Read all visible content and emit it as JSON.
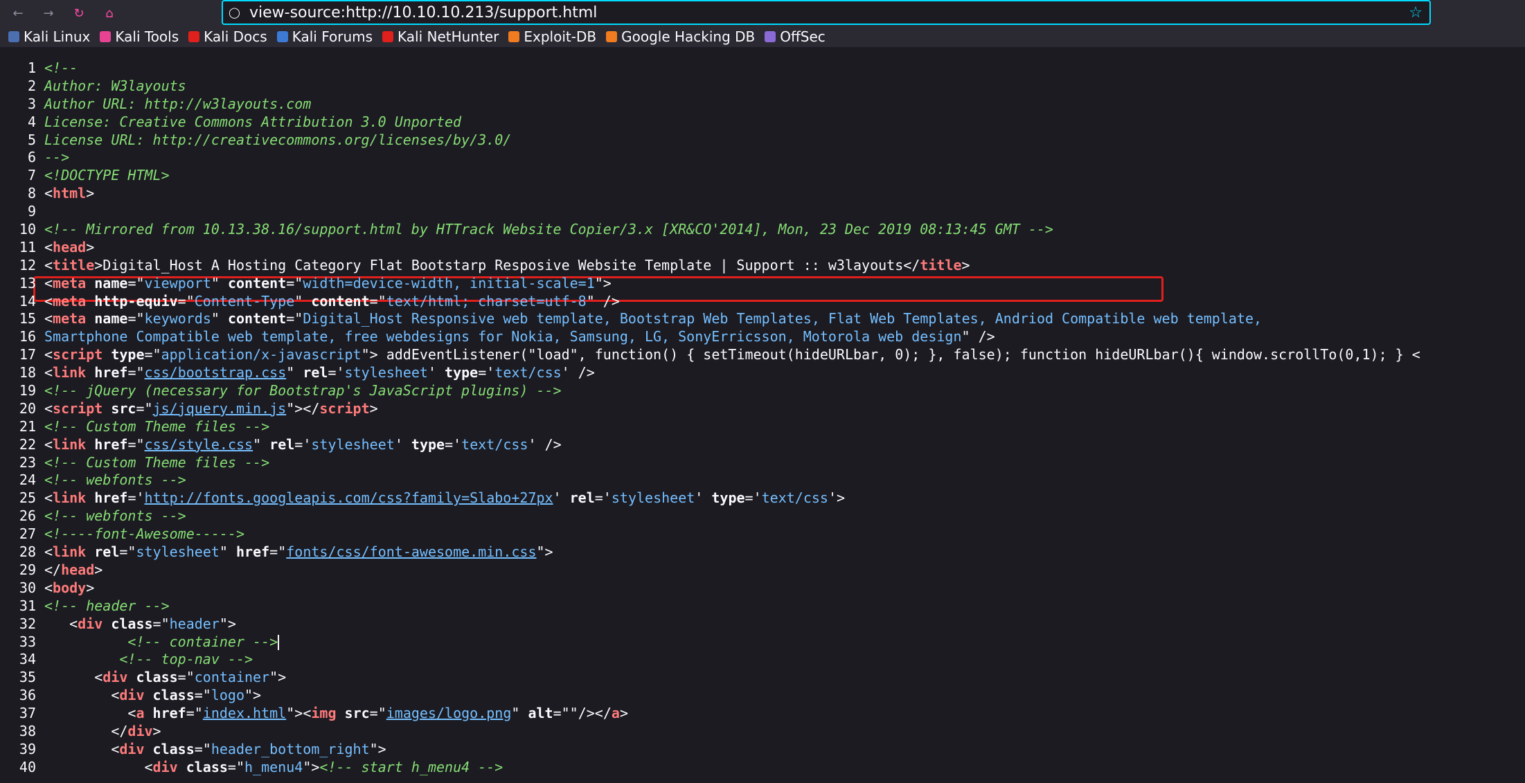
{
  "browser": {
    "url": "view-source:http://10.10.10.213/support.html",
    "bookmarks": [
      {
        "label": "Kali Linux",
        "color": "#4b6fb0"
      },
      {
        "label": "Kali Tools",
        "color": "#e84393"
      },
      {
        "label": "Kali Docs",
        "color": "#e0201c"
      },
      {
        "label": "Kali Forums",
        "color": "#3d7ad6"
      },
      {
        "label": "Kali NetHunter",
        "color": "#e0201c"
      },
      {
        "label": "Exploit-DB",
        "color": "#f07b20"
      },
      {
        "label": "Google Hacking DB",
        "color": "#f07b20"
      },
      {
        "label": "OffSec",
        "color": "#8a6bd6"
      }
    ]
  },
  "source_lines": [
    {
      "n": "1",
      "parts": [
        [
          "c",
          "<!--"
        ]
      ]
    },
    {
      "n": "2",
      "parts": [
        [
          "c",
          "Author: W3layouts"
        ]
      ]
    },
    {
      "n": "3",
      "parts": [
        [
          "c",
          "Author URL: http://w3layouts.com"
        ]
      ]
    },
    {
      "n": "4",
      "parts": [
        [
          "c",
          "License: Creative Commons Attribution 3.0 Unported"
        ]
      ]
    },
    {
      "n": "5",
      "parts": [
        [
          "c",
          "License URL: http://creativecommons.org/licenses/by/3.0/"
        ]
      ]
    },
    {
      "n": "6",
      "parts": [
        [
          "c",
          "-->"
        ]
      ]
    },
    {
      "n": "7",
      "parts": [
        [
          "c",
          "<!DOCTYPE HTML>"
        ]
      ]
    },
    {
      "n": "8",
      "parts": [
        [
          "p",
          "<"
        ],
        [
          "t",
          "html"
        ],
        [
          "p",
          ">"
        ]
      ]
    },
    {
      "n": "9",
      "parts": []
    },
    {
      "n": "10",
      "parts": [
        [
          "c",
          "<!-- Mirrored from 10.13.38.16/support.html by HTTrack Website Copier/3.x [XR&CO'2014], Mon, 23 Dec 2019 08:13:45 GMT -->"
        ]
      ]
    },
    {
      "n": "11",
      "parts": [
        [
          "p",
          "<"
        ],
        [
          "t",
          "head"
        ],
        [
          "p",
          ">"
        ]
      ]
    },
    {
      "n": "12",
      "parts": [
        [
          "p",
          "<"
        ],
        [
          "t",
          "title"
        ],
        [
          "p",
          ">Digital_Host A Hosting Category Flat Bootstarp Resposive Website Template | Support :: w3layouts</"
        ],
        [
          "t",
          "title"
        ],
        [
          "p",
          ">"
        ]
      ]
    },
    {
      "n": "13",
      "parts": [
        [
          "p",
          "<"
        ],
        [
          "t",
          "meta"
        ],
        [
          "a",
          " name"
        ],
        [
          "p",
          "=\""
        ],
        [
          "v",
          "viewport"
        ],
        [
          "p",
          "\""
        ],
        [
          "a",
          " content"
        ],
        [
          "p",
          "=\""
        ],
        [
          "v",
          "width=device-width, initial-scale=1"
        ],
        [
          "p",
          "\">"
        ]
      ]
    },
    {
      "n": "14",
      "parts": [
        [
          "p",
          "<"
        ],
        [
          "t",
          "meta"
        ],
        [
          "a",
          " http-equiv"
        ],
        [
          "p",
          "=\""
        ],
        [
          "v",
          "Content-Type"
        ],
        [
          "p",
          "\""
        ],
        [
          "a",
          " content"
        ],
        [
          "p",
          "=\""
        ],
        [
          "v",
          "text/html; charset=utf-8"
        ],
        [
          "p",
          "\" />"
        ]
      ]
    },
    {
      "n": "15",
      "parts": [
        [
          "p",
          "<"
        ],
        [
          "t",
          "meta"
        ],
        [
          "a",
          " name"
        ],
        [
          "p",
          "=\""
        ],
        [
          "v",
          "keywords"
        ],
        [
          "p",
          "\""
        ],
        [
          "a",
          " content"
        ],
        [
          "p",
          "=\""
        ],
        [
          "v",
          "Digital_Host Responsive web template, Bootstrap Web Templates, Flat Web Templates, Andriod Compatible web template,"
        ]
      ]
    },
    {
      "n": "16",
      "parts": [
        [
          "v",
          "Smartphone Compatible web template, free webdesigns for Nokia, Samsung, LG, SonyErricsson, Motorola web design"
        ],
        [
          "p",
          "\" />"
        ]
      ]
    },
    {
      "n": "17",
      "parts": [
        [
          "p",
          "<"
        ],
        [
          "t",
          "script"
        ],
        [
          "a",
          " type"
        ],
        [
          "p",
          "=\""
        ],
        [
          "v",
          "application/x-javascript"
        ],
        [
          "p",
          "\"> addEventListener(\"load\", function() { setTimeout(hideURLbar, 0); }, false); function hideURLbar(){ window.scrollTo(0,1); } <"
        ]
      ]
    },
    {
      "n": "18",
      "parts": [
        [
          "p",
          "<"
        ],
        [
          "t",
          "link"
        ],
        [
          "a",
          " href"
        ],
        [
          "p",
          "=\""
        ],
        [
          "u",
          "css/bootstrap.css"
        ],
        [
          "p",
          "\""
        ],
        [
          "a",
          " rel"
        ],
        [
          "p",
          "='"
        ],
        [
          "v",
          "stylesheet"
        ],
        [
          "p",
          "'"
        ],
        [
          "a",
          " type"
        ],
        [
          "p",
          "='"
        ],
        [
          "v",
          "text/css"
        ],
        [
          "p",
          "' />"
        ]
      ]
    },
    {
      "n": "19",
      "parts": [
        [
          "c",
          "<!-- jQuery (necessary for Bootstrap's JavaScript plugins) -->"
        ]
      ]
    },
    {
      "n": "20",
      "parts": [
        [
          "p",
          "<"
        ],
        [
          "t",
          "script"
        ],
        [
          "a",
          " src"
        ],
        [
          "p",
          "=\""
        ],
        [
          "u",
          "js/jquery.min.js"
        ],
        [
          "p",
          "\"></"
        ],
        [
          "t",
          "script"
        ],
        [
          "p",
          ">"
        ]
      ]
    },
    {
      "n": "21",
      "parts": [
        [
          "c",
          "<!-- Custom Theme files -->"
        ]
      ]
    },
    {
      "n": "22",
      "parts": [
        [
          "p",
          "<"
        ],
        [
          "t",
          "link"
        ],
        [
          "a",
          " href"
        ],
        [
          "p",
          "=\""
        ],
        [
          "u",
          "css/style.css"
        ],
        [
          "p",
          "\""
        ],
        [
          "a",
          " rel"
        ],
        [
          "p",
          "='"
        ],
        [
          "v",
          "stylesheet"
        ],
        [
          "p",
          "'"
        ],
        [
          "a",
          " type"
        ],
        [
          "p",
          "='"
        ],
        [
          "v",
          "text/css"
        ],
        [
          "p",
          "' />"
        ]
      ]
    },
    {
      "n": "23",
      "parts": [
        [
          "c",
          "<!-- Custom Theme files -->"
        ]
      ]
    },
    {
      "n": "24",
      "parts": [
        [
          "c",
          "<!-- webfonts -->"
        ]
      ]
    },
    {
      "n": "25",
      "parts": [
        [
          "p",
          "<"
        ],
        [
          "t",
          "link"
        ],
        [
          "a",
          " href"
        ],
        [
          "p",
          "='"
        ],
        [
          "u",
          "http://fonts.googleapis.com/css?family=Slabo+27px"
        ],
        [
          "p",
          "'"
        ],
        [
          "a",
          " rel"
        ],
        [
          "p",
          "='"
        ],
        [
          "v",
          "stylesheet"
        ],
        [
          "p",
          "'"
        ],
        [
          "a",
          " type"
        ],
        [
          "p",
          "='"
        ],
        [
          "v",
          "text/css"
        ],
        [
          "p",
          "'>"
        ]
      ]
    },
    {
      "n": "26",
      "parts": [
        [
          "c",
          "<!-- webfonts -->"
        ]
      ]
    },
    {
      "n": "27",
      "parts": [
        [
          "c",
          "<!----font-Awesome----->"
        ]
      ]
    },
    {
      "n": "28",
      "parts": [
        [
          "p",
          "<"
        ],
        [
          "t",
          "link"
        ],
        [
          "a",
          " rel"
        ],
        [
          "p",
          "=\""
        ],
        [
          "v",
          "stylesheet"
        ],
        [
          "p",
          "\""
        ],
        [
          "a",
          " href"
        ],
        [
          "p",
          "=\""
        ],
        [
          "u",
          "fonts/css/font-awesome.min.css"
        ],
        [
          "p",
          "\">"
        ]
      ]
    },
    {
      "n": "29",
      "parts": [
        [
          "p",
          "</"
        ],
        [
          "t",
          "head"
        ],
        [
          "p",
          ">"
        ]
      ]
    },
    {
      "n": "30",
      "parts": [
        [
          "p",
          "<"
        ],
        [
          "t",
          "body"
        ],
        [
          "p",
          ">"
        ]
      ]
    },
    {
      "n": "31",
      "parts": [
        [
          "c",
          "<!-- header -->"
        ]
      ]
    },
    {
      "n": "32",
      "parts": [
        [
          "p",
          "   <"
        ],
        [
          "t",
          "div"
        ],
        [
          "a",
          " class"
        ],
        [
          "p",
          "=\""
        ],
        [
          "v",
          "header"
        ],
        [
          "p",
          "\">"
        ]
      ]
    },
    {
      "n": "33",
      "parts": [
        [
          "p",
          "          "
        ],
        [
          "c",
          "<!-- container -->"
        ]
      ]
    },
    {
      "n": "34",
      "parts": [
        [
          "p",
          "         "
        ],
        [
          "c",
          "<!-- top-nav -->"
        ]
      ]
    },
    {
      "n": "35",
      "parts": [
        [
          "p",
          "      <"
        ],
        [
          "t",
          "div"
        ],
        [
          "a",
          " class"
        ],
        [
          "p",
          "=\""
        ],
        [
          "v",
          "container"
        ],
        [
          "p",
          "\">"
        ]
      ]
    },
    {
      "n": "36",
      "parts": [
        [
          "p",
          "        <"
        ],
        [
          "t",
          "div"
        ],
        [
          "a",
          " class"
        ],
        [
          "p",
          "=\""
        ],
        [
          "v",
          "logo"
        ],
        [
          "p",
          "\">"
        ]
      ]
    },
    {
      "n": "37",
      "parts": [
        [
          "p",
          "          <"
        ],
        [
          "t",
          "a"
        ],
        [
          "a",
          " href"
        ],
        [
          "p",
          "=\""
        ],
        [
          "u",
          "index.html"
        ],
        [
          "p",
          "\"><"
        ],
        [
          "t",
          "img"
        ],
        [
          "a",
          " src"
        ],
        [
          "p",
          "=\""
        ],
        [
          "u",
          "images/logo.png"
        ],
        [
          "p",
          "\""
        ],
        [
          "a",
          " alt"
        ],
        [
          "p",
          "=\"\"/></"
        ],
        [
          "t",
          "a"
        ],
        [
          "p",
          ">"
        ]
      ]
    },
    {
      "n": "38",
      "parts": [
        [
          "p",
          "        </"
        ],
        [
          "t",
          "div"
        ],
        [
          "p",
          ">"
        ]
      ]
    },
    {
      "n": "39",
      "parts": [
        [
          "p",
          "        <"
        ],
        [
          "t",
          "div"
        ],
        [
          "a",
          " class"
        ],
        [
          "p",
          "=\""
        ],
        [
          "v",
          "header_bottom_right"
        ],
        [
          "p",
          "\">"
        ]
      ]
    },
    {
      "n": "40",
      "parts": [
        [
          "p",
          "            <"
        ],
        [
          "t",
          "div"
        ],
        [
          "a",
          " class"
        ],
        [
          "p",
          "=\""
        ],
        [
          "v",
          "h_menu4"
        ],
        [
          "p",
          "\">"
        ],
        [
          "c",
          "<!-- start h_menu4 -->"
        ]
      ]
    }
  ]
}
